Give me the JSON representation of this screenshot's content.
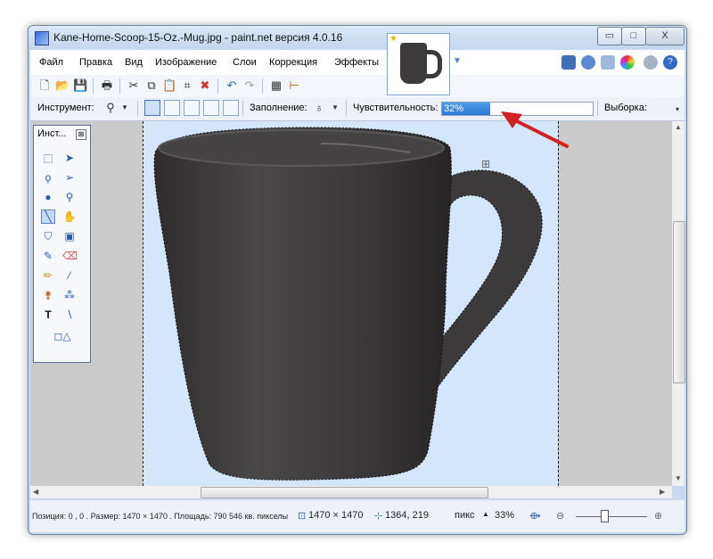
{
  "window": {
    "title": "Kane-Home-Scoop-15-Oz.-Mug.jpg - paint.net версия 4.0.16",
    "min_label": "▭",
    "max_label": "□",
    "close_label": "X"
  },
  "menu": [
    "Файл",
    "Правка",
    "Вид",
    "Изображение",
    "Слои",
    "Коррекция",
    "Эффекты"
  ],
  "toolbar2": {
    "tool_label": "Инструмент:",
    "fill_label": "Заполнение:",
    "sensitivity_label": "Чувствительность:",
    "sensitivity_value": "32%",
    "sensitivity_fraction": 0.32,
    "selection_label": "Выборка:"
  },
  "tools_window": {
    "title": "Инст...",
    "close": "⊠"
  },
  "status": {
    "info": "Позиция: 0 , 0 . Размер: 1470  × 1470 . Площадь: 790 546 кв. пикселы",
    "size": "1470 × 1470",
    "pos": "1364, 219",
    "unit": "пикс",
    "zoom": "33%"
  },
  "colors": {
    "accent": "#2b7ad4",
    "mug": "#3c3a3b",
    "selection_bg": "#d3e6fb",
    "arrow": "#d42020"
  }
}
